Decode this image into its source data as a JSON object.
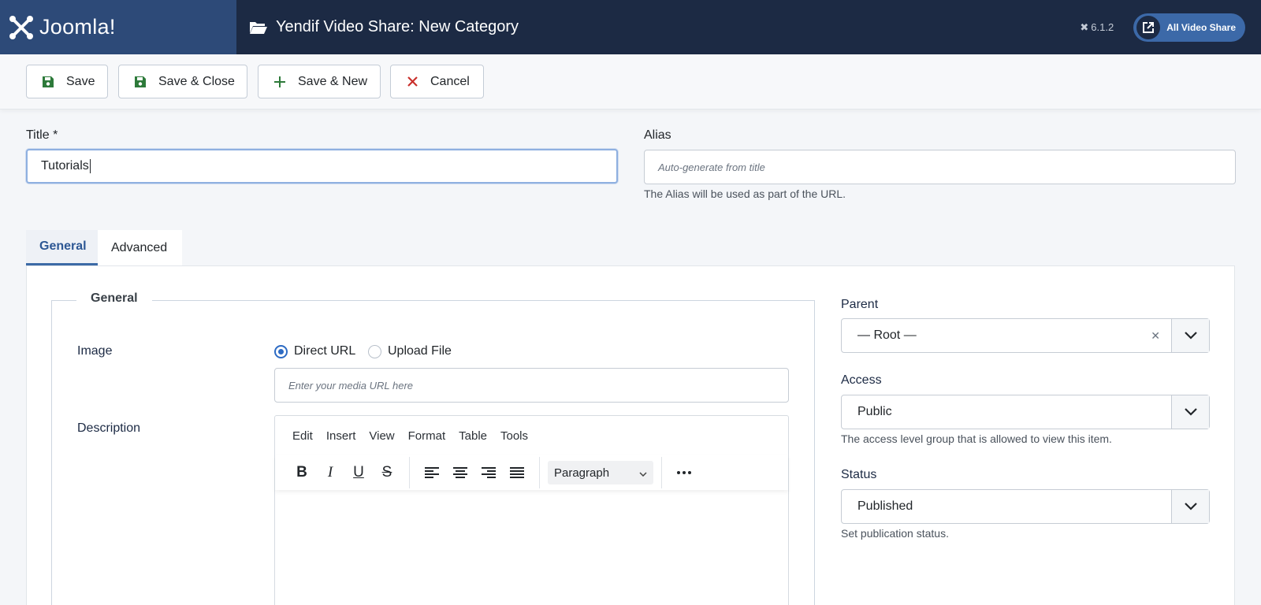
{
  "header": {
    "logo_text": "Joomla!",
    "title": "Yendif Video Share: New Category",
    "version": "6.1.2",
    "site_button": "All Video Share"
  },
  "toolbar": {
    "save": "Save",
    "save_close": "Save & Close",
    "save_new": "Save & New",
    "cancel": "Cancel"
  },
  "form": {
    "title_label": "Title *",
    "title_value": "Tutorials",
    "alias_label": "Alias",
    "alias_placeholder": "Auto-generate from title",
    "alias_help": "The Alias will be used as part of the URL."
  },
  "tabs": [
    "General",
    "Advanced"
  ],
  "general": {
    "legend": "General",
    "image_label": "Image",
    "radio_direct": "Direct URL",
    "radio_upload": "Upload File",
    "radio_selected": "Direct URL",
    "media_placeholder": "Enter your media URL here",
    "description_label": "Description",
    "editor_menu": [
      "Edit",
      "Insert",
      "View",
      "Format",
      "Table",
      "Tools"
    ],
    "editor_block_format": "Paragraph"
  },
  "sidebar": {
    "parent_label": "Parent",
    "parent_value": "— Root —",
    "access_label": "Access",
    "access_value": "Public",
    "access_help": "The access level group that is allowed to view this item.",
    "status_label": "Status",
    "status_value": "Published",
    "status_help": "Set publication status."
  },
  "colors": {
    "header_bg": "#1c2a44",
    "logo_bg": "#2d4a78",
    "accent": "#3c6aa6",
    "save_icon": "#2d7a3a",
    "cancel_icon": "#c9302c"
  }
}
